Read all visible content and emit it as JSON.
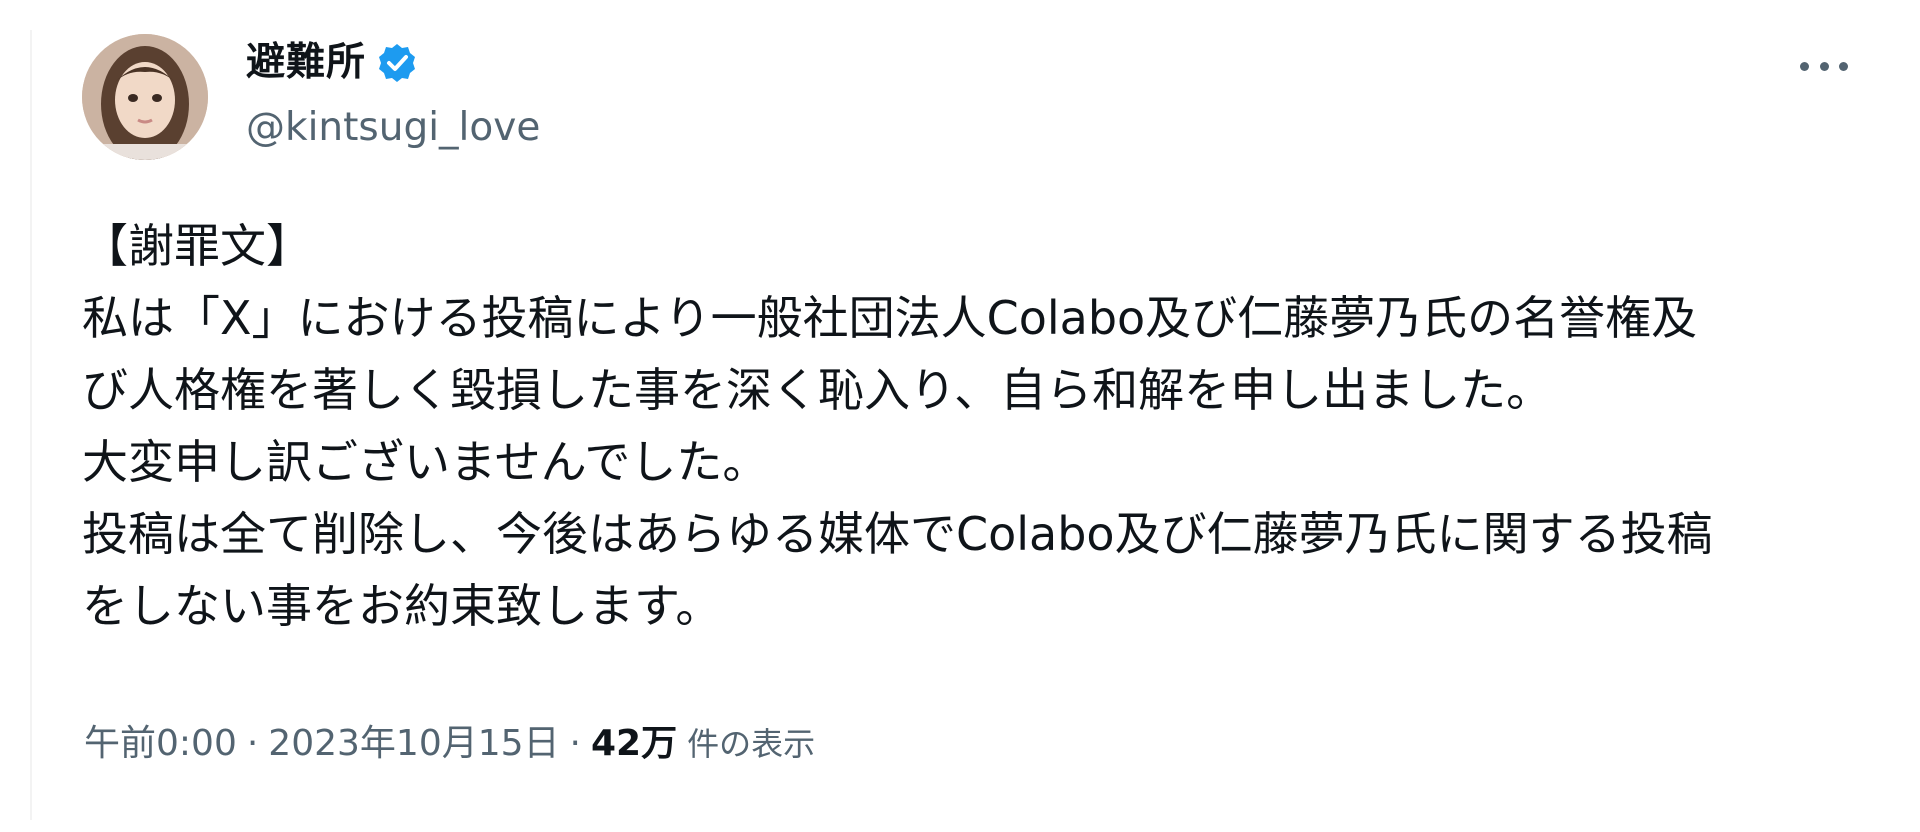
{
  "post": {
    "author": {
      "display_name": "避難所",
      "handle": "@kintsugi_love",
      "verified": true
    },
    "body_lines": [
      "【謝罪文】",
      "私は「X」における投稿により一般社団法人Colabo及び仁藤夢乃氏の名誉権及",
      "び人格権を著しく毀損した事を深く恥入り、自ら和解を申し出ました。",
      "大変申し訳ございませんでした。",
      "投稿は全て削除し、今後はあらゆる媒体でColabo及び仁藤夢乃氏に関する投稿",
      "をしない事をお約束致します。"
    ],
    "meta": {
      "time": "午前0:00",
      "separator": "·",
      "date": "2023年10月15日",
      "views_count": "42万",
      "views_label": "件の表示"
    }
  },
  "icons": {
    "verified": "verified-badge-icon",
    "more": "more-options-icon"
  },
  "colors": {
    "verified": "#1d9bf0",
    "secondary_text": "#536471",
    "primary_text": "#0f1419"
  }
}
